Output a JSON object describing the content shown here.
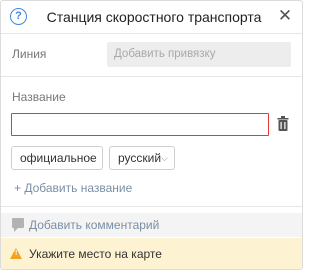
{
  "header": {
    "title": "Станция скоростного транспорта",
    "help_icon": "help-circle-icon",
    "close_icon": "close-icon",
    "help_glyph": "?",
    "close_glyph": "✕"
  },
  "line": {
    "label": "Линия",
    "binding_placeholder": "Добавить привязку"
  },
  "name": {
    "label": "Название",
    "value": "",
    "type_select": {
      "selected": "официальное"
    },
    "language_select": {
      "selected": "русский"
    },
    "add_name_label": "+ Добавить название"
  },
  "comment": {
    "label": "Добавить комментарий"
  },
  "warning": {
    "text": "Укажите место на карте",
    "color": "#f2a31b"
  },
  "colors": {
    "accent": "#3f87e0",
    "error_border": "#e53935",
    "link": "#7a8fa5",
    "warning_background": "#fdf3d2"
  }
}
